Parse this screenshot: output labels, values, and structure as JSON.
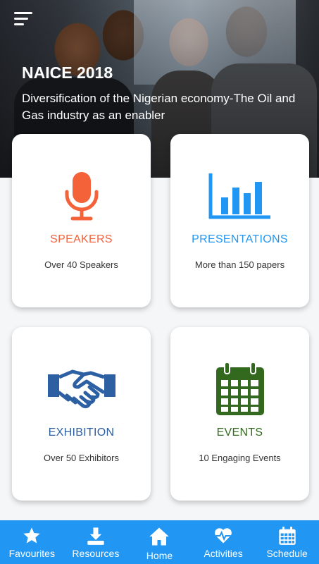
{
  "header": {
    "title": "NAICE 2018",
    "subtitle": "Diversification of the Nigerian economy-The Oil and Gas industry as an enabler"
  },
  "cards": [
    {
      "label": "SPEAKERS",
      "desc": "Over 40 Speakers",
      "icon": "microphone-icon",
      "color": "#f4623a"
    },
    {
      "label": "PRESENTATIONS",
      "desc": "More than 150 papers",
      "icon": "bar-chart-icon",
      "color": "#2196f3"
    },
    {
      "label": "EXHIBITION",
      "desc": "Over 50 Exhibitors",
      "icon": "handshake-icon",
      "color": "#2d5fa3"
    },
    {
      "label": "EVENTS",
      "desc": "10 Engaging Events",
      "icon": "calendar-icon",
      "color": "#33691e"
    }
  ],
  "nav": [
    {
      "label": "Favourites",
      "icon": "star-icon"
    },
    {
      "label": "Resources",
      "icon": "download-icon"
    },
    {
      "label": "Home",
      "icon": "home-icon",
      "active": true
    },
    {
      "label": "Activities",
      "icon": "heart-pulse-icon"
    },
    {
      "label": "Schedule",
      "icon": "calendar-grid-icon"
    }
  ],
  "colors": {
    "nav_bg": "#2196f3",
    "speakers": "#f4623a",
    "presentations": "#2196f3",
    "exhibition": "#2d5fa3",
    "events": "#33691e"
  }
}
